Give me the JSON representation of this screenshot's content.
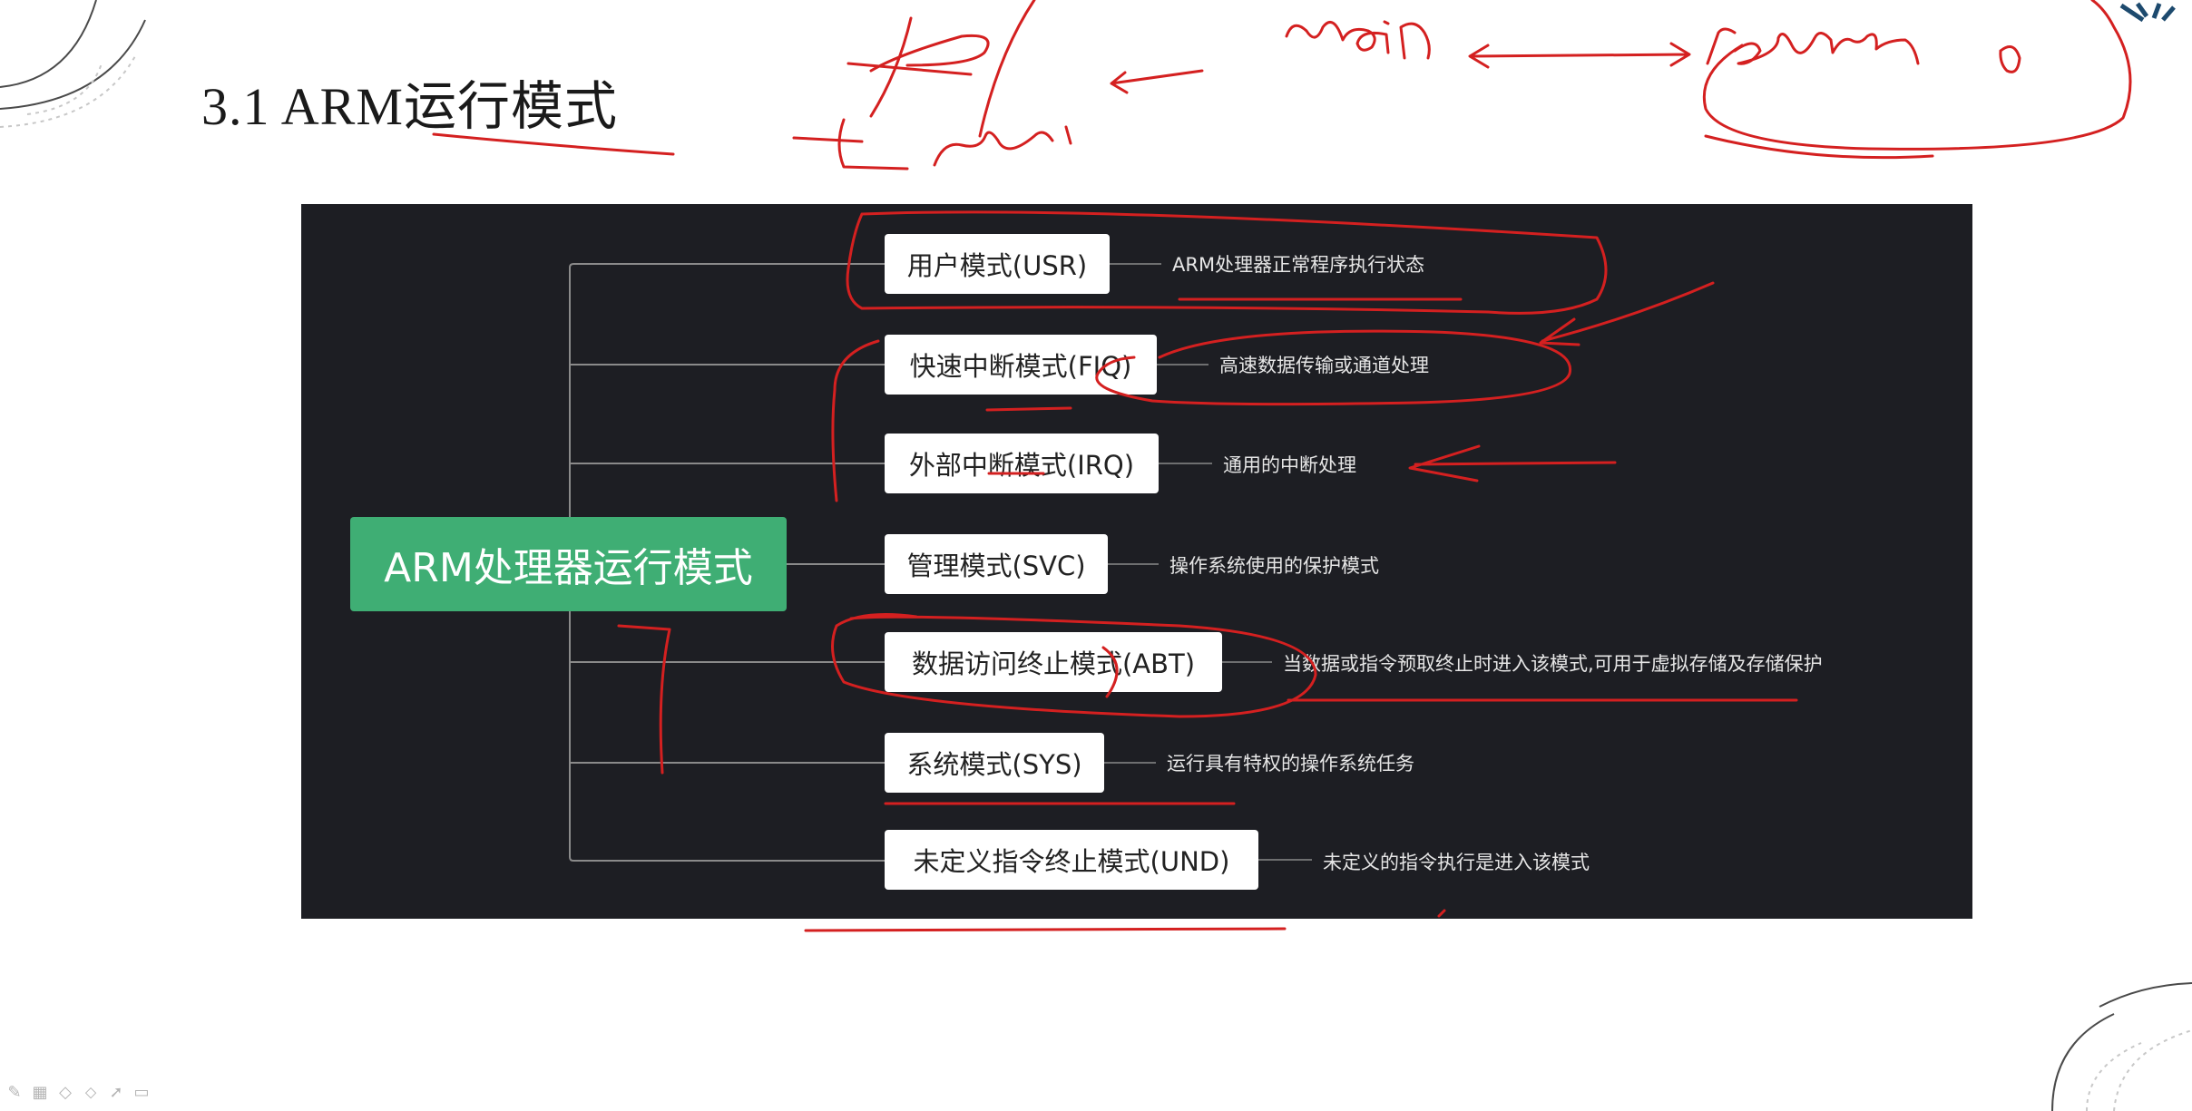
{
  "slide": {
    "title": "3.1 ARM运行模式"
  },
  "mindmap": {
    "root_label": "ARM处理器运行模式",
    "colors": {
      "background": "#1d1e23",
      "root": "#3fae74",
      "node": "#ffffff",
      "connector": "#8a8a8a"
    },
    "modes": [
      {
        "label": "用户模式(USR)",
        "desc": "ARM处理器正常程序执行状态"
      },
      {
        "label": "快速中断模式(FIQ)",
        "desc": "高速数据传输或通道处理"
      },
      {
        "label": "外部中断模式(IRQ)",
        "desc": "通用的中断处理"
      },
      {
        "label": "管理模式(SVC)",
        "desc": "操作系统使用的保护模式"
      },
      {
        "label": "数据访问终止模式(ABT)",
        "desc": "当数据或指令预取终止时进入该模式,可用于虚拟存储及存储保护"
      },
      {
        "label": "系统模式(SYS)",
        "desc": "运行具有特权的操作系统任务"
      },
      {
        "label": "未定义指令终止模式(UND)",
        "desc": "未定义的指令执行是进入该模式"
      }
    ]
  },
  "annotations": {
    "ink_color": "#d42020"
  },
  "toolbar": {
    "icons": [
      "pen-icon",
      "grid-icon",
      "eraser-icon",
      "marker-icon",
      "pointer-icon",
      "camera-icon"
    ]
  }
}
